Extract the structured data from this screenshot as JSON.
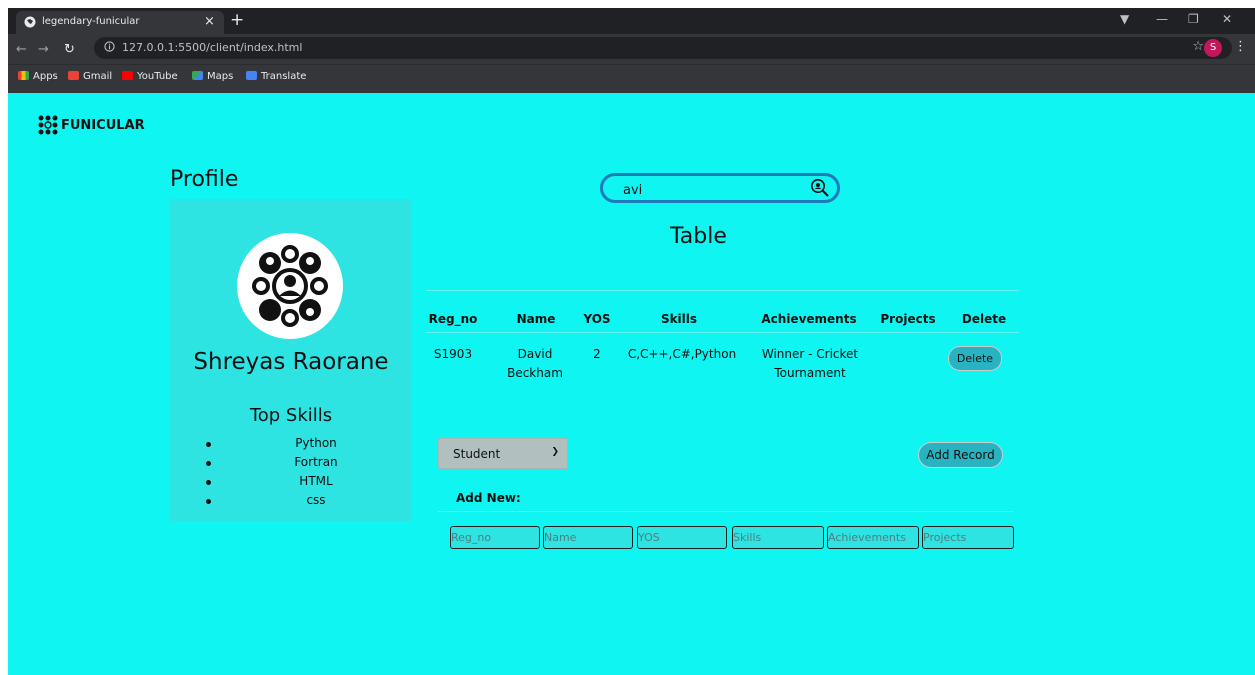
{
  "browser": {
    "tab_title": "legendary-funicular",
    "tab_close": "×",
    "new_tab": "+",
    "url": "127.0.0.1:5500/client/index.html",
    "profile_initial": "S",
    "bookmarks": [
      {
        "label": "Apps",
        "icon": "apps-grid-icon",
        "color": "#e53935"
      },
      {
        "label": "Gmail",
        "icon": "gmail-icon",
        "color": "#ea4335"
      },
      {
        "label": "YouTube",
        "icon": "youtube-icon",
        "color": "#ff0000"
      },
      {
        "label": "Maps",
        "icon": "maps-icon",
        "color": "#34a853"
      },
      {
        "label": "Translate",
        "icon": "translate-icon",
        "color": "#4285f4"
      }
    ]
  },
  "brand": {
    "name": "FUNICULAR"
  },
  "profile": {
    "heading": "Profile",
    "name": "Shreyas Raorane",
    "skills_heading": "Top Skills",
    "skills": [
      "Python",
      "Fortran",
      "HTML",
      "css"
    ]
  },
  "search": {
    "value": "avi"
  },
  "table": {
    "title": "Table",
    "headers": [
      "Reg_no",
      "Name",
      "YOS",
      "Skills",
      "Achievements",
      "Projects",
      "Delete"
    ],
    "rows": [
      {
        "reg_no": "S1903",
        "name_line1": "David",
        "name_line2": "Beckham",
        "yos": "2",
        "skills": "C,C++,C#,Python",
        "ach_line1": "Winner - Cricket",
        "ach_line2": "Tournament",
        "projects": "",
        "delete_label": "Delete"
      }
    ]
  },
  "form": {
    "select_value": "Student",
    "add_label": "Add Record",
    "add_new_label": "Add New:",
    "placeholders": {
      "reg_no": "Reg_no",
      "name": "Name",
      "yos": "YOS",
      "skills": "Skills",
      "achievements": "Achievements",
      "projects": "Projects"
    }
  },
  "colors": {
    "page_bg": "#0ef5f2",
    "card_bg": "#2ee4e3",
    "button_bg": "#28b3c0",
    "search_border": "#1e7ab8"
  }
}
